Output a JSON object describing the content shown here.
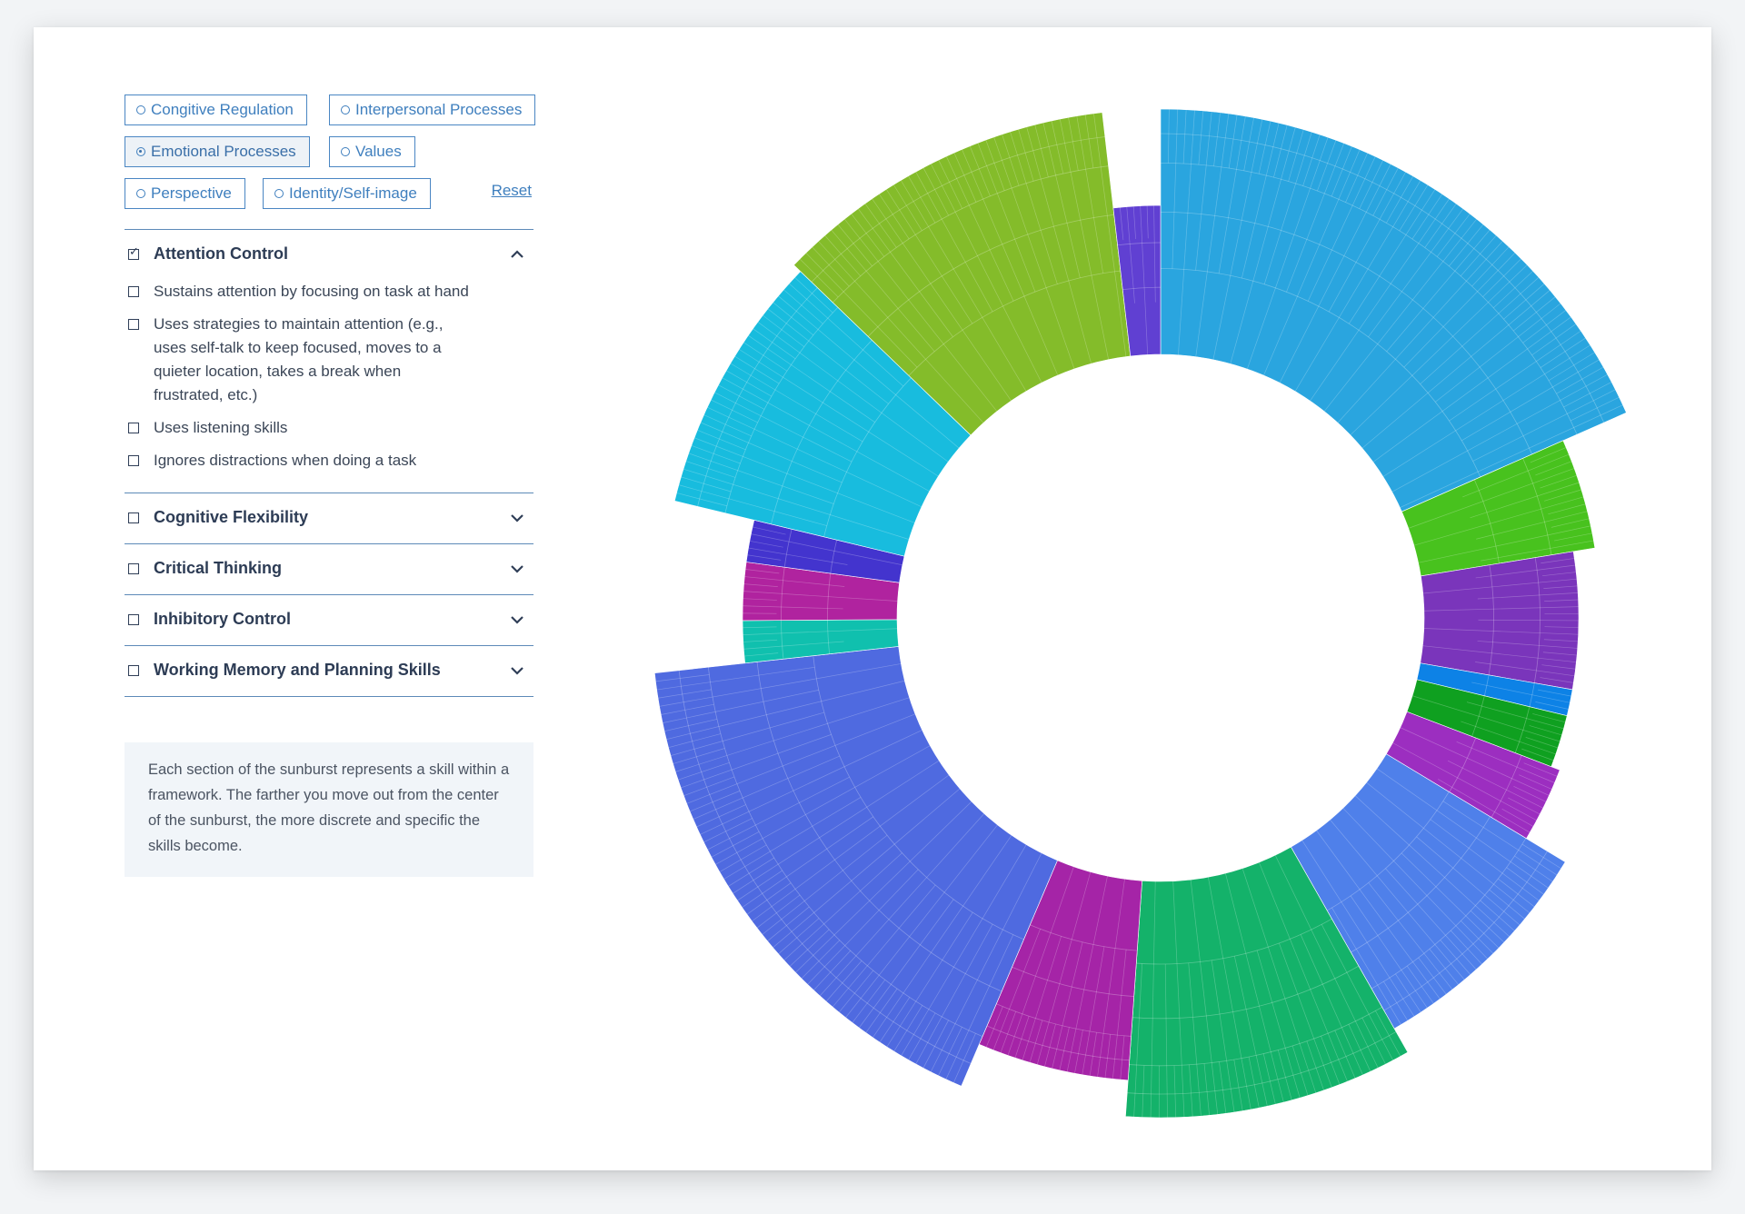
{
  "filters": [
    {
      "label": "Congitive Regulation",
      "selected": false
    },
    {
      "label": "Interpersonal Processes",
      "selected": false
    },
    {
      "label": "Emotional Processes",
      "selected": true
    },
    {
      "label": "Values",
      "selected": false
    },
    {
      "label": "Perspective",
      "selected": false
    },
    {
      "label": "Identity/Self-image",
      "selected": false
    }
  ],
  "reset_label": "Reset",
  "sections": [
    {
      "title": "Attention Control",
      "checked": true,
      "expanded": true,
      "items": [
        "Sustains attention by focusing on task at hand",
        "Uses strategies to maintain attention (e.g., uses self-talk to keep focused, moves to a quieter location, takes a break when frustrated, etc.)",
        "Uses listening skills",
        "Ignores distractions when doing a task"
      ]
    },
    {
      "title": "Cognitive Flexibility",
      "checked": false,
      "expanded": false
    },
    {
      "title": "Critical Thinking",
      "checked": false,
      "expanded": false
    },
    {
      "title": "Inhibitory Control",
      "checked": false,
      "expanded": false
    },
    {
      "title": "Working Memory and Planning Skills",
      "checked": false,
      "expanded": false
    }
  ],
  "info_text": "Each section of the sunburst represents a skill within a framework. The farther you move out from the center of the sunburst, the more discrete and specific the skills become.",
  "chart_data": {
    "type": "sunburst",
    "segments": [
      {
        "color": "#2aa5df",
        "share": 0.181,
        "depth": 1.0
      },
      {
        "color": "#48c21e",
        "share": 0.04,
        "depth": 0.62
      },
      {
        "color": "#7a35bb",
        "share": 0.052,
        "depth": 0.5
      },
      {
        "color": "#0d82e6",
        "share": 0.01,
        "depth": 0.5
      },
      {
        "color": "#0fa020",
        "share": 0.02,
        "depth": 0.5
      },
      {
        "color": "#9c2ec0",
        "share": 0.028,
        "depth": 0.55
      },
      {
        "color": "#4f80ea",
        "share": 0.08,
        "depth": 0.8
      },
      {
        "color": "#14b26a",
        "share": 0.092,
        "depth": 0.95
      },
      {
        "color": "#a524a7",
        "share": 0.052,
        "depth": 0.75
      },
      {
        "color": "#4f6ae0",
        "share": 0.166,
        "depth": 1.0
      },
      {
        "color": "#10c0ae",
        "share": 0.016,
        "depth": 0.5
      },
      {
        "color": "#b0239f",
        "share": 0.022,
        "depth": 0.5
      },
      {
        "color": "#4334ce",
        "share": 0.016,
        "depth": 0.5
      },
      {
        "color": "#18bcde",
        "share": 0.083,
        "depth": 0.95
      },
      {
        "color": "#84bc2a",
        "share": 0.108,
        "depth": 1.0
      },
      {
        "color": "#6040d2",
        "share": 0.018,
        "depth": 0.47
      }
    ]
  }
}
